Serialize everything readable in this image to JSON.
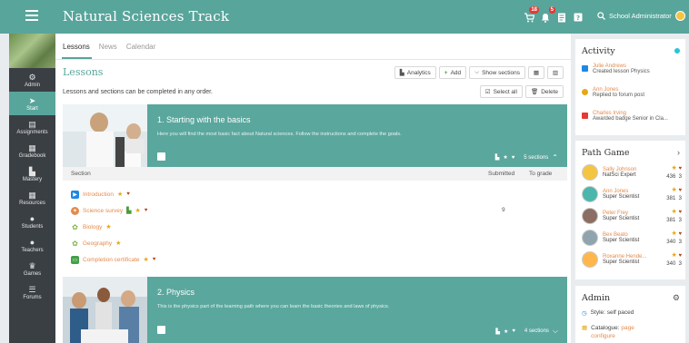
{
  "app": {
    "title": "Natural Sciences Track"
  },
  "topbar": {
    "user_label": "School Administrator",
    "badges": [
      "18",
      "5"
    ],
    "icons": [
      "cart-icon",
      "bell-icon",
      "document-icon",
      "help-icon",
      "search-icon"
    ]
  },
  "sidebar": {
    "items": [
      {
        "label": "Admin",
        "icon": "gear-icon"
      },
      {
        "label": "Start",
        "icon": "paper-plane-icon",
        "active": true
      },
      {
        "label": "Assignments",
        "icon": "assignment-icon"
      },
      {
        "label": "Gradebook",
        "icon": "gradebook-icon"
      },
      {
        "label": "Mastery",
        "icon": "bar-chart-icon"
      },
      {
        "label": "Resources",
        "icon": "resources-icon"
      },
      {
        "label": "Students",
        "icon": "person-icon"
      },
      {
        "label": "Teachers",
        "icon": "teacher-icon"
      },
      {
        "label": "Games",
        "icon": "trophy-icon"
      },
      {
        "label": "Forums",
        "icon": "forum-icon"
      }
    ]
  },
  "main": {
    "tabs": [
      "Lessons",
      "News",
      "Calendar"
    ],
    "heading": "Lessons",
    "description": "Lessons and sections can be completed in any order.",
    "buttons": {
      "analytics": "Analytics",
      "add": "Add",
      "show_sections": "Show sections",
      "select_all": "Select all",
      "delete": "Delete"
    },
    "sections": [
      {
        "title": "1. Starting with the basics",
        "description": "Here you will find the most basic fact about Natural sciences. Follow the instructions and complete the goals.",
        "count": "5 sections",
        "columns": {
          "section": "Section",
          "submitted": "Submitted",
          "grade": "To grade"
        },
        "lessons": [
          {
            "label": "Introduction",
            "color": "#1e88e5"
          },
          {
            "label": "Science survey",
            "color": "#e48b4d",
            "submitted": "9"
          },
          {
            "label": "Biology",
            "color": "#7cb342"
          },
          {
            "label": "Geography",
            "color": "#7cb342"
          },
          {
            "label": "Completion certificate",
            "color": "#43a047"
          }
        ]
      },
      {
        "title": "2. Physics",
        "description": "This is the physics part of the learning path where you can learn the basic theories and laws of physics.",
        "count": "4 sections"
      }
    ]
  },
  "activity": {
    "title": "Activity",
    "items": [
      {
        "name": "Julie Andrews",
        "text": "Created lesson Physics",
        "color": "#1e88e5"
      },
      {
        "name": "Ann Jones",
        "text": "Replied to forum post",
        "color": "#e6a817"
      },
      {
        "name": "Charles Irving",
        "text": "Awarded badge Senior in Cla...",
        "color": "#e53935"
      }
    ]
  },
  "path_game": {
    "title": "Path Game",
    "players": [
      {
        "name": "Sally Johnson",
        "rank": "NatSci Expert",
        "points": "436",
        "badges": "3",
        "avatar_color": "#f4c542"
      },
      {
        "name": "Ann Jones",
        "rank": "Super Scientist",
        "points": "381",
        "badges": "3",
        "avatar_color": "#4db6ac"
      },
      {
        "name": "Peter Frey",
        "rank": "Super Scientist",
        "points": "381",
        "badges": "3",
        "avatar_color": "#8d6e63"
      },
      {
        "name": "Bex Beato",
        "rank": "Super Scientist",
        "points": "340",
        "badges": "3",
        "avatar_color": "#90a4ae"
      },
      {
        "name": "Roxanne Hende...",
        "rank": "Super Scientist",
        "points": "340",
        "badges": "3",
        "avatar_color": "#ffb74d"
      }
    ]
  },
  "admin": {
    "title": "Admin",
    "style": "Style: self paced",
    "catalogue_label": "Catalogue:",
    "catalogue_link": "page",
    "configure_link": "configure"
  }
}
